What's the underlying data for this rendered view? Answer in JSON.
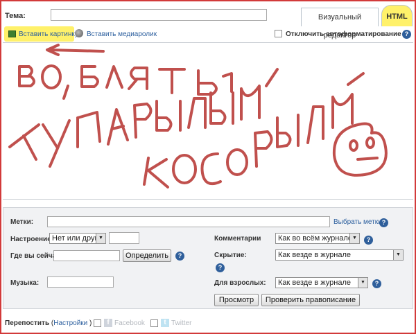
{
  "header": {
    "subject_label": "Тема:",
    "subject_value": "",
    "tabs": [
      {
        "label": "Визуальный редактор",
        "active": false
      },
      {
        "label": "HTML",
        "active": true
      }
    ]
  },
  "toolbar": {
    "insert_image": "Вставить картинку",
    "insert_video": "Вставить медиаролик",
    "autoformat_label": "Отключить автоформатирование",
    "autoformat_checked": false
  },
  "editor": {
    "content": ""
  },
  "options": {
    "tags_label": "Метки:",
    "tags_value": "",
    "choose_tags": "Выбрать метки",
    "mood_label": "Настроение:",
    "mood_value": "Нет или другое",
    "mood_custom": "",
    "comments_label": "Комментарии",
    "comments_value": "Как во всём журнале",
    "location_label": "Где вы сейчас:",
    "location_value": "",
    "detect_button": "Определить",
    "privacy_label": "Скрытие:",
    "privacy_value": "Как везде в журнале",
    "music_label": "Музыка:",
    "music_value": "",
    "adult_label": "Для взрослых:",
    "adult_value": "Как везде в журнале",
    "preview_button": "Просмотр",
    "spellcheck_button": "Проверить правописание"
  },
  "footer": {
    "crosspost_label": "Перепостить",
    "settings_open": "(",
    "settings_link": "Настройки",
    "settings_close": ")",
    "facebook": "Facebook",
    "twitter": "Twitter"
  },
  "help_glyph": "?",
  "select_arrow": "▼",
  "colors": {
    "highlight": "#fff16a",
    "scribble": "#c0504d",
    "link": "#2c5f9e",
    "help": "#2f5f9b"
  }
}
